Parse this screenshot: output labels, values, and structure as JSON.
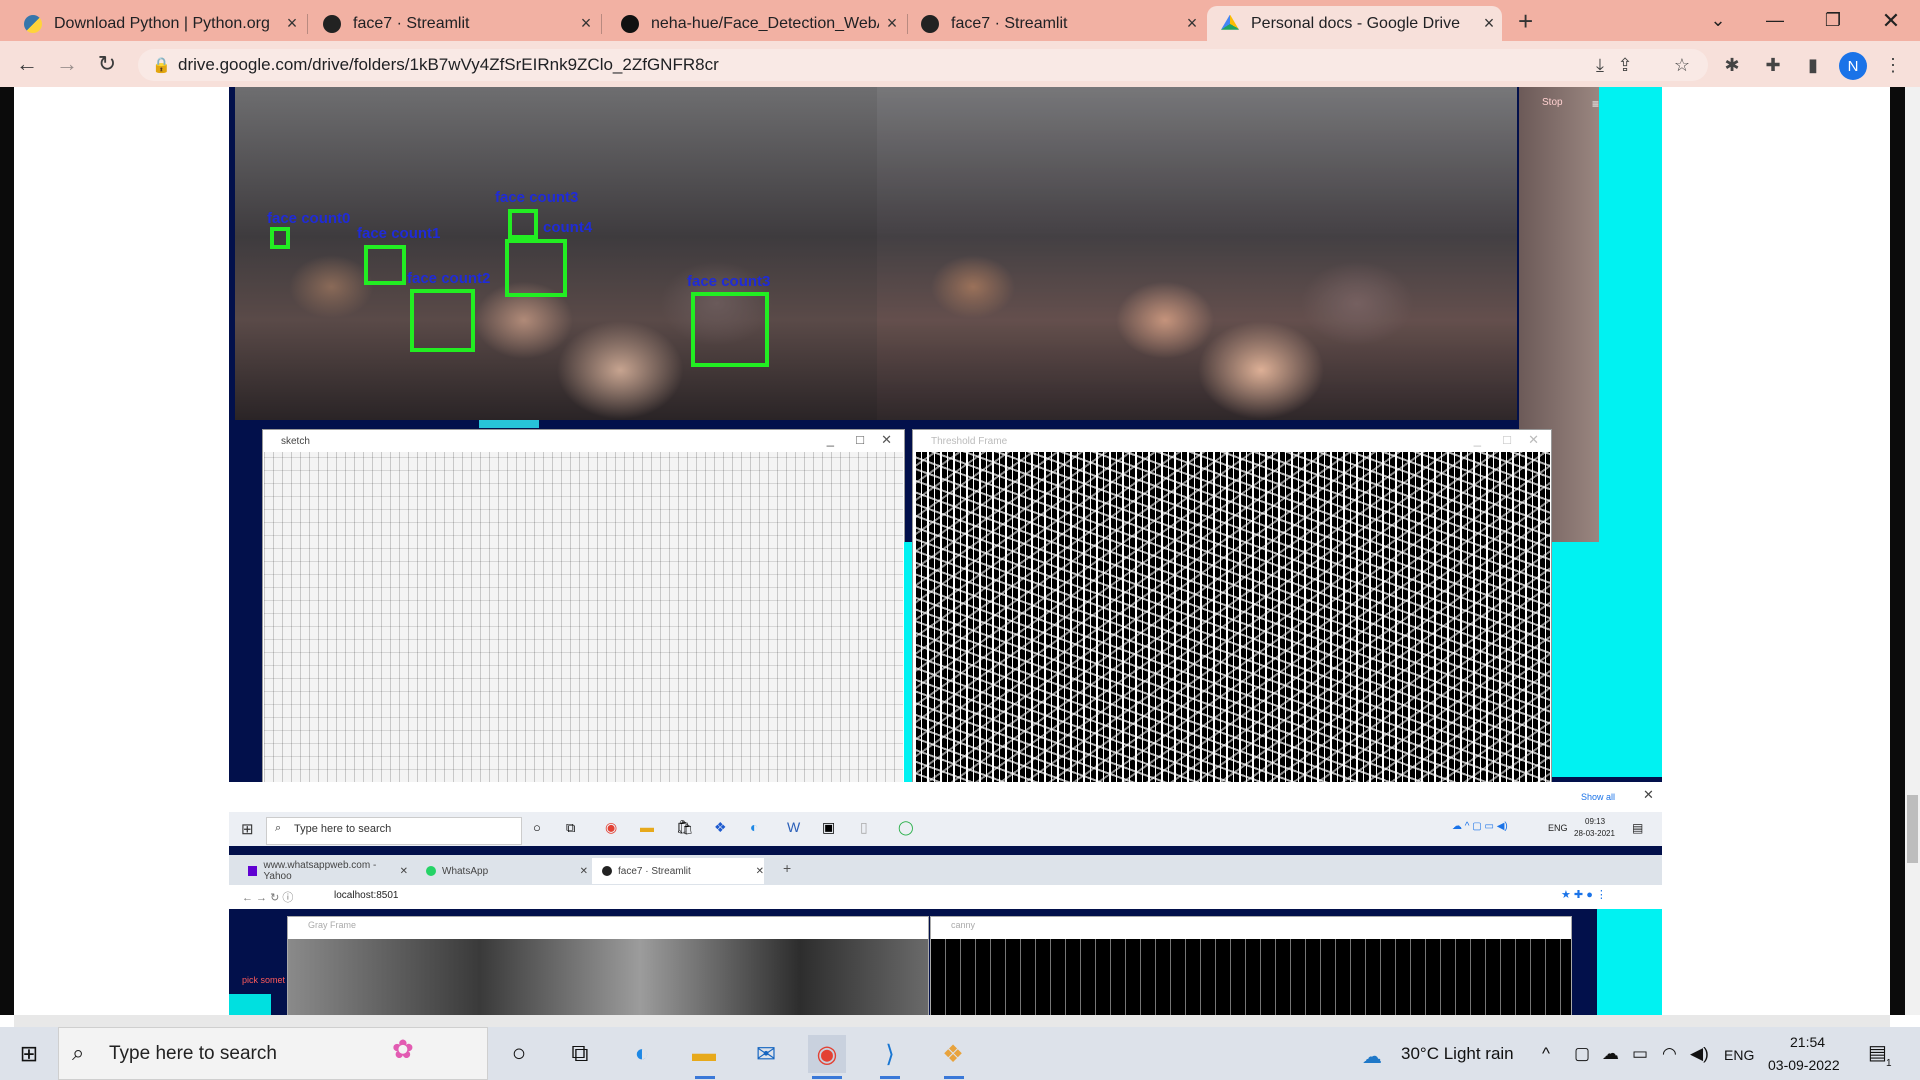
{
  "browser": {
    "tabs": [
      {
        "title": "Download Python | Python.org",
        "icon": "python-icon",
        "color": "#3776ab"
      },
      {
        "title": "face7 · Streamlit",
        "icon": "streamlit-crown-icon",
        "color": "#202124"
      },
      {
        "title": "neha-hue/Face_Detection_WebApp",
        "icon": "github-icon",
        "color": "#202124"
      },
      {
        "title": "face7 · Streamlit",
        "icon": "streamlit-crown-icon",
        "color": "#202124"
      },
      {
        "title": "Personal docs - Google Drive",
        "icon": "google-drive-icon",
        "color": "#1fa463",
        "active": true
      }
    ],
    "new_tab": "+",
    "url": "drive.google.com/drive/folders/1kB7wVy4ZfSrEIRnk9ZClo_2ZfGNFR8cr",
    "profile_initial": "N"
  },
  "screenshot": {
    "face_labels": [
      "face count0",
      "face count1",
      "face count2",
      "face count3",
      "face count3",
      "count4"
    ],
    "windows": {
      "sketch": "sketch",
      "threshold": "Threshold Frame",
      "gray": "Gray Frame",
      "canny": "canny"
    },
    "show_all": "Show all",
    "inner_search_placeholder": "Type here to search",
    "inner_clock_time": "09:13",
    "inner_clock_date": "28-03-2021",
    "inner_lang": "ENG",
    "inner_tabs": [
      "www.whatsappweb.com - Yahoo",
      "WhatsApp",
      "face7 · Streamlit"
    ],
    "inner_url": "localhost:8501",
    "inner_sidebar_text": "pick somet",
    "stop_label": "Stop"
  },
  "taskbar": {
    "search_placeholder": "Type here to search",
    "weather": "30°C  Light rain",
    "lang": "ENG",
    "time": "21:54",
    "date": "03-09-2022",
    "notification_count": "1"
  }
}
